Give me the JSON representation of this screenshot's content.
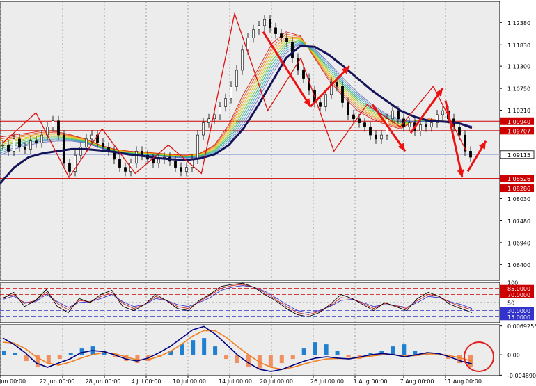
{
  "chart_data": {
    "type": "candlestick",
    "instrument_hint": "",
    "colors": {
      "background": "#ececec",
      "plot": "#ececec",
      "grid": "#7a7a7a",
      "axis_text": "#000000",
      "price_line": "#cc0000",
      "current_line": "#9aa8d8",
      "slow_ma": "#14145a",
      "ribbon": [
        "#d40000",
        "#e84a00",
        "#f08a00",
        "#e8c000",
        "#b8d400",
        "#60c040",
        "#20b070",
        "#20a8b0",
        "#4088d0",
        "#6060c0"
      ],
      "candle": "#000000",
      "arrow": "#ee1111",
      "osc_black": "#000000",
      "osc_red": "#cc2222",
      "osc_blue": "#3333cc",
      "macd_pos": "#1f7fd0",
      "macd_neg": "#f09060",
      "macd_line": "#000080",
      "signal_line": "#f08020",
      "annotation_circle": "#e02020"
    },
    "main": {
      "y_ticks": [
        "1.12380",
        "1.11830",
        "1.11300",
        "1.10750",
        "1.10210",
        "1.09115",
        "1.08030",
        "1.07480",
        "1.06940",
        "1.06400"
      ],
      "y_tick_values": [
        1.1238,
        1.1183,
        1.113,
        1.1075,
        1.1021,
        1.09115,
        1.0803,
        1.0748,
        1.0694,
        1.064
      ],
      "ylim": [
        1.0601,
        1.129
      ],
      "horizontal_levels": [
        {
          "label": "1.09940",
          "value": 1.0994,
          "color": "#cc0000",
          "box": true
        },
        {
          "label": "1.09707",
          "value": 1.09707,
          "color": "#cc0000",
          "box": true
        },
        {
          "label": "1.09115",
          "value": 1.09115,
          "color": "#9aa8d8",
          "box": false,
          "current": true
        },
        {
          "label": "1.08526",
          "value": 1.08526,
          "color": "#cc0000",
          "box": true
        },
        {
          "label": "1.08286",
          "value": 1.08286,
          "color": "#cc0000",
          "box": true
        }
      ],
      "close_series": [
        1.0935,
        1.092,
        1.095,
        1.093,
        1.0925,
        1.0945,
        1.094,
        1.096,
        1.098,
        1.0995,
        1.096,
        1.089,
        1.087,
        1.091,
        1.093,
        1.095,
        1.096,
        1.094,
        1.093,
        1.092,
        1.09,
        1.088,
        1.087,
        1.089,
        1.092,
        1.091,
        1.09,
        1.089,
        1.09,
        1.0905,
        1.0895,
        1.088,
        1.087,
        1.088,
        1.09,
        1.096,
        1.099,
        1.1,
        1.101,
        1.103,
        1.105,
        1.108,
        1.112,
        1.117,
        1.12,
        1.122,
        1.123,
        1.1245,
        1.1225,
        1.121,
        1.12,
        1.119,
        1.115,
        1.112,
        1.11,
        1.107,
        1.104,
        1.103,
        1.106,
        1.109,
        1.108,
        1.104,
        1.101,
        1.1,
        1.099,
        1.098,
        1.096,
        1.095,
        1.096,
        1.1,
        1.102,
        1.1,
        1.098,
        1.099,
        1.097,
        1.0985,
        1.098,
        1.099,
        1.101,
        1.102,
        1.1,
        1.098,
        1.096,
        1.092,
        1.0905
      ],
      "ribbon_levels": [
        [
          1.0955,
          1.096,
          1.0965,
          1.097,
          1.0968,
          1.096,
          1.095,
          1.0935,
          1.0925,
          1.092,
          1.0918,
          1.0915,
          1.0912,
          1.091,
          1.0915,
          1.0935,
          1.0985,
          1.106,
          1.112,
          1.1185,
          1.1215,
          1.1205,
          1.115,
          1.1095,
          1.1055,
          1.102,
          1.1,
          1.0985,
          1.0975,
          1.0995,
          1.1,
          1.0995,
          1.099,
          1.0975
        ],
        [
          1.094,
          1.095,
          1.0955,
          1.096,
          1.096,
          1.0955,
          1.0945,
          1.0932,
          1.0922,
          1.0918,
          1.0915,
          1.0913,
          1.091,
          1.0908,
          1.0912,
          1.0928,
          1.0968,
          1.1035,
          1.1095,
          1.116,
          1.12,
          1.12,
          1.116,
          1.111,
          1.107,
          1.1035,
          1.101,
          1.0992,
          1.0982,
          1.099,
          1.0996,
          1.0995,
          1.099,
          1.0978
        ],
        [
          1.0925,
          1.0938,
          1.0945,
          1.095,
          1.0952,
          1.095,
          1.0942,
          1.093,
          1.092,
          1.0916,
          1.0913,
          1.0911,
          1.0908,
          1.0906,
          1.0908,
          1.092,
          1.0952,
          1.101,
          1.107,
          1.1135,
          1.1182,
          1.1193,
          1.1168,
          1.1125,
          1.1085,
          1.105,
          1.1022,
          1.1002,
          1.099,
          1.099,
          1.0994,
          1.0994,
          1.099,
          1.098
        ],
        [
          1.091,
          1.0925,
          1.0935,
          1.0942,
          1.0945,
          1.0945,
          1.094,
          1.0928,
          1.0918,
          1.0913,
          1.091,
          1.0908,
          1.0905,
          1.0903,
          1.0905,
          1.0913,
          1.0938,
          1.0985,
          1.1045,
          1.111,
          1.1162,
          1.1185,
          1.1173,
          1.1138,
          1.11,
          1.1065,
          1.1035,
          1.1012,
          1.0998,
          1.0993,
          1.0993,
          1.0994,
          1.099,
          1.0982
        ]
      ],
      "slow_ma": [
        1.084,
        1.088,
        1.0905,
        1.0915,
        1.092,
        1.0925,
        1.0925,
        1.0922,
        1.0918,
        1.0912,
        1.0908,
        1.0903,
        1.09,
        1.0898,
        1.0902,
        1.0912,
        1.0935,
        1.0975,
        1.103,
        1.109,
        1.115,
        1.118,
        1.1178,
        1.1158,
        1.113,
        1.11,
        1.107,
        1.1045,
        1.102,
        1.1005,
        1.0995,
        1.0993,
        1.099,
        1.0978
      ],
      "zigzag": [
        1.094,
        1.1015,
        1.0855,
        1.0975,
        1.0865,
        1.0935,
        1.0865,
        1.126,
        1.102,
        1.115,
        1.092,
        1.1035,
        1.098,
        1.108,
        1.092
      ],
      "arrows": [
        {
          "from": [
            1.1215,
            null
          ],
          "to": [
            1.103,
            null
          ]
        },
        {
          "from": [
            1.103,
            null
          ],
          "to": [
            1.113,
            null
          ]
        },
        {
          "from": [
            1.1035,
            null
          ],
          "to": [
            1.092,
            null
          ]
        },
        {
          "from": [
            1.0965,
            null
          ],
          "to": [
            1.1075,
            null
          ]
        },
        {
          "from": [
            1.1045,
            null
          ],
          "to": [
            1.0855,
            null
          ]
        },
        {
          "from": [
            1.087,
            null
          ],
          "to": [
            1.0945,
            null
          ]
        }
      ]
    },
    "x_ticks": [
      "Jun 00:00",
      "22 Jun 00:00",
      "28 Jun 00:00",
      "4 Jul 00:00",
      "10 Jul 00:00",
      "14 Jul 00:00",
      "20 Jul 00:00",
      "26 Jul 00:00",
      "1 Aug 00:00",
      "7 Aug 00:00",
      "11 Aug 00:00"
    ],
    "stoch": {
      "levels": [
        {
          "label": "100",
          "value": 100,
          "box": false
        },
        {
          "label": "85.0000",
          "value": 85,
          "box": true,
          "color": "#cc0000"
        },
        {
          "label": "70.0000",
          "value": 70,
          "box": true,
          "color": "#cc0000"
        },
        {
          "label": "50",
          "value": 50,
          "box": false
        },
        {
          "label": "30.0000",
          "value": 30,
          "box": true,
          "color": "#3333cc"
        },
        {
          "label": "15.0000",
          "value": 15,
          "box": true,
          "color": "#3333cc"
        }
      ],
      "ylim": [
        0,
        100
      ],
      "black": [
        60,
        75,
        40,
        55,
        82,
        40,
        25,
        60,
        50,
        70,
        80,
        40,
        30,
        45,
        70,
        55,
        35,
        30,
        55,
        70,
        90,
        95,
        98,
        88,
        70,
        55,
        35,
        20,
        15,
        25,
        45,
        70,
        60,
        45,
        30,
        50,
        40,
        30,
        60,
        75,
        65,
        45,
        35,
        25
      ],
      "red": [
        62,
        70,
        48,
        55,
        75,
        48,
        32,
        55,
        52,
        65,
        75,
        48,
        35,
        45,
        65,
        55,
        40,
        35,
        52,
        68,
        85,
        92,
        95,
        88,
        75,
        58,
        40,
        25,
        20,
        28,
        42,
        62,
        60,
        48,
        35,
        48,
        42,
        35,
        55,
        70,
        65,
        50,
        40,
        32
      ],
      "blue": [
        58,
        66,
        50,
        52,
        70,
        52,
        38,
        50,
        52,
        60,
        70,
        52,
        40,
        45,
        60,
        55,
        45,
        40,
        50,
        62,
        80,
        88,
        92,
        88,
        78,
        62,
        45,
        30,
        25,
        30,
        40,
        55,
        58,
        50,
        40,
        45,
        42,
        38,
        50,
        65,
        62,
        52,
        45,
        35
      ]
    },
    "macd": {
      "levels": [
        {
          "label": "0.0069255",
          "value": 0.0069255
        },
        {
          "label": "0.00",
          "value": 0.0
        },
        {
          "label": "-0.0048908",
          "value": -0.0048908
        }
      ],
      "ylim": [
        -0.005,
        0.0072
      ],
      "hist": [
        0.001,
        0.0005,
        -0.0015,
        -0.003,
        -0.002,
        -0.001,
        0.0005,
        0.0015,
        0.002,
        0.001,
        -0.0005,
        -0.0015,
        -0.002,
        -0.0015,
        -0.0005,
        0.001,
        0.0025,
        0.0035,
        0.004,
        0.002,
        -0.001,
        -0.002,
        -0.003,
        -0.0035,
        -0.003,
        -0.002,
        -0.001,
        0.0015,
        0.003,
        0.0025,
        0.001,
        -0.0005,
        -0.001,
        0.0005,
        0.001,
        0.002,
        0.0025,
        0.001,
        0.0005,
        0.0003,
        -0.001,
        -0.002,
        -0.003
      ],
      "macd_line": [
        0.004,
        0.0025,
        0.0005,
        -0.002,
        -0.003,
        -0.002,
        -0.001,
        0.0005,
        0.001,
        0.0008,
        0.0,
        -0.001,
        -0.0015,
        -0.0008,
        0.0005,
        0.002,
        0.004,
        0.006,
        0.0068,
        0.005,
        0.0025,
        0.0,
        -0.002,
        -0.0035,
        -0.004,
        -0.0035,
        -0.0025,
        -0.0015,
        -0.0008,
        -0.0005,
        -0.0008,
        -0.001,
        -0.0005,
        0.0,
        0.0003,
        0.0,
        -0.0005,
        0.0,
        0.0005,
        0.0003,
        -0.0005,
        -0.0015,
        -0.0022
      ],
      "signal_line": [
        0.003,
        0.0028,
        0.0015,
        -0.0005,
        -0.002,
        -0.0025,
        -0.0018,
        -0.0008,
        0.0,
        0.0005,
        0.0003,
        -0.0005,
        -0.0012,
        -0.0012,
        -0.0004,
        0.0008,
        0.0025,
        0.0045,
        0.0058,
        0.0058,
        0.0042,
        0.002,
        0.0,
        -0.0018,
        -0.003,
        -0.0035,
        -0.003,
        -0.0022,
        -0.0015,
        -0.001,
        -0.0009,
        -0.0009,
        -0.0007,
        -0.0003,
        0.0,
        0.0,
        -0.0003,
        -0.0002,
        0.0002,
        0.0002,
        -0.0002,
        -0.0008,
        -0.0015
      ]
    }
  }
}
